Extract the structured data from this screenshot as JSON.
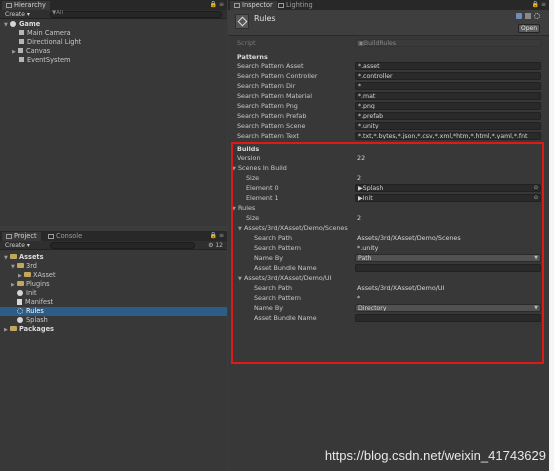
{
  "hierarchy": {
    "tab": "Hierarchy",
    "create": "Create",
    "search_hint": "▼All",
    "scene": "Game",
    "items": [
      "Main Camera",
      "Directional Light",
      "Canvas",
      "EventSystem"
    ]
  },
  "project": {
    "tabs": [
      "Project",
      "Console"
    ],
    "create": "Create",
    "count": "12",
    "tree": [
      {
        "label": "Assets",
        "icon": "folder-icon",
        "bold": true
      },
      {
        "label": "3rd",
        "icon": "folder-icon"
      },
      {
        "label": "XAsset",
        "icon": "folder-icon"
      },
      {
        "label": "Plugins",
        "icon": "folder-icon"
      },
      {
        "label": "Init",
        "icon": "unity-scene-icon"
      },
      {
        "label": "Manifest",
        "icon": "document-icon"
      },
      {
        "label": "Rules",
        "icon": "gear-icon",
        "selected": true
      },
      {
        "label": "Splash",
        "icon": "unity-scene-icon"
      },
      {
        "label": "Packages",
        "icon": "folder-icon",
        "bold": true
      }
    ]
  },
  "inspector": {
    "tabs": [
      "Inspector",
      "Lighting"
    ],
    "title": "Rules",
    "open_button": "Open",
    "script_label": "Script",
    "script_value": "BuildRules",
    "patterns_header": "Patterns",
    "patterns": [
      {
        "label": "Search Pattern Asset",
        "value": "*.asset"
      },
      {
        "label": "Search Pattern Controller",
        "value": "*.controller"
      },
      {
        "label": "Search Pattern Dir",
        "value": "*"
      },
      {
        "label": "Search Pattern Material",
        "value": "*.mat"
      },
      {
        "label": "Search Pattern Png",
        "value": "*.png"
      },
      {
        "label": "Search Pattern Prefab",
        "value": "*.prefab"
      },
      {
        "label": "Search Pattern Scene",
        "value": "*.unity"
      },
      {
        "label": "Search Pattern Text",
        "value": "*.txt,*.bytes,*.json,*.csv,*.xml,*htm,*.html,*.yaml,*.fnt"
      }
    ],
    "builds_header": "Builds",
    "version_label": "Version",
    "version_value": "22",
    "scenes_label": "Scenes In Build",
    "size_label": "Size",
    "scenes_size": "2",
    "element0_label": "Element 0",
    "element0_value": "Splash",
    "element1_label": "Element 1",
    "element1_value": "Init",
    "rules_label": "Rules",
    "rules_size": "2",
    "rules": [
      {
        "header": "Assets/3rd/XAsset/Demo/Scenes",
        "search_path_label": "Search Path",
        "search_path": "Assets/3rd/XAsset/Demo/Scenes",
        "search_pattern_label": "Search Pattern",
        "search_pattern": "*.unity",
        "name_by_label": "Name By",
        "name_by": "Path",
        "bundle_label": "Asset Bundle Name",
        "bundle": ""
      },
      {
        "header": "Assets/3rd/XAsset/Demo/UI",
        "search_path_label": "Search Path",
        "search_path": "Assets/3rd/XAsset/Demo/UI",
        "search_pattern_label": "Search Pattern",
        "search_pattern": "*",
        "name_by_label": "Name By",
        "name_by": "Directory",
        "bundle_label": "Asset Bundle Name",
        "bundle": ""
      }
    ]
  },
  "watermark": "https://blog.csdn.net/weixin_41743629",
  "colors": {
    "highlight_box": "#e01818",
    "selection": "#2c5d87",
    "background": "#383838"
  }
}
